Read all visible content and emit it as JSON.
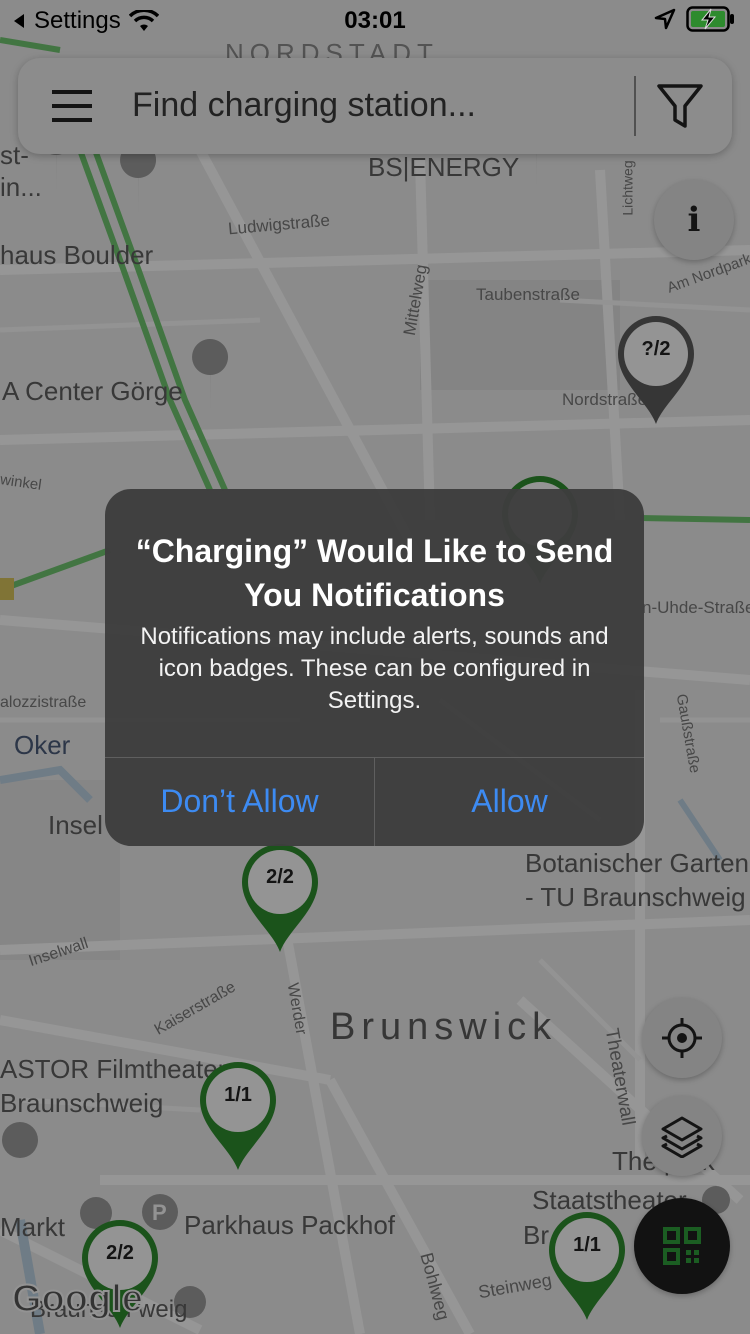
{
  "status_bar": {
    "back_label": "Settings",
    "time": "03:01"
  },
  "search": {
    "placeholder": "Find charging station..."
  },
  "map": {
    "labels": {
      "nordstadt": "NORDSTADT",
      "bs_energy": "BS|ENERGY",
      "ludwigstrasse": "Ludwigstraße",
      "lichtweg": "Lichtweg",
      "am_nordpark": "Am Nordpark",
      "boulder": "haus Boulder",
      "st": "st-",
      "in": "in...",
      "taubenstrasse": "Taubenstraße",
      "mittelweg": "Mittelweg",
      "nordstrasse": "Nordstraße",
      "a_center": "A Center Görge",
      "winkel": "winkel",
      "uhde": "n-Uhde-Straße",
      "alozzi": "alozzistraße",
      "gaussstrasse": "Gaußstraße",
      "oker": "Oker",
      "insel": "Insel",
      "botanischer": "Botanischer Garten",
      "tu": "- TU Braunschweig",
      "inselwall": "Inselwall",
      "kaiserstrasse": "Kaiserstraße",
      "werder": "Werder",
      "brunswick": "Brunswick",
      "theaterwall": "Theaterwall",
      "astor": "ASTOR Filmtheater",
      "braunschweig": "Braunschweig",
      "the_park": "The park",
      "staatstheater": "Staatstheater",
      "br": "Br",
      "markt": "Markt",
      "packhof": "Parkhaus Packhof",
      "steinweg": "Steinweg",
      "bohlweg": "Bohlweg",
      "braunsch_bottom": "Braunsch weig",
      "google": "Google"
    },
    "pins": [
      {
        "label": "?/2",
        "color": "#555555"
      },
      {
        "label": "2/2",
        "color": "#2e8b2e"
      },
      {
        "label": "1/1",
        "color": "#2e8b2e"
      },
      {
        "label": "2/2",
        "color": "#2e8b2e"
      },
      {
        "label": "1/1",
        "color": "#2e8b2e"
      }
    ]
  },
  "fabs": {
    "info": "i"
  },
  "alert": {
    "title": "“Charging” Would Like to Send You Notifications",
    "message": "Notifications may include alerts, sounds and icon badges. These can be configured in Settings.",
    "deny_label": "Don’t Allow",
    "allow_label": "Allow"
  },
  "colors": {
    "accent": "#3d8bf2",
    "pin_green": "#2e8b2e",
    "qr_green": "#2e9b3a"
  }
}
